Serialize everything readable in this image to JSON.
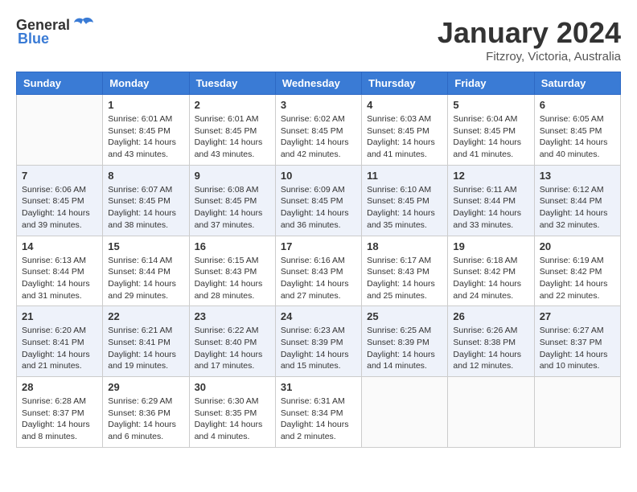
{
  "logo": {
    "general": "General",
    "blue": "Blue"
  },
  "title": "January 2024",
  "subtitle": "Fitzroy, Victoria, Australia",
  "days_of_week": [
    "Sunday",
    "Monday",
    "Tuesday",
    "Wednesday",
    "Thursday",
    "Friday",
    "Saturday"
  ],
  "weeks": [
    [
      {
        "day": "",
        "info": ""
      },
      {
        "day": "1",
        "info": "Sunrise: 6:01 AM\nSunset: 8:45 PM\nDaylight: 14 hours\nand 43 minutes."
      },
      {
        "day": "2",
        "info": "Sunrise: 6:01 AM\nSunset: 8:45 PM\nDaylight: 14 hours\nand 43 minutes."
      },
      {
        "day": "3",
        "info": "Sunrise: 6:02 AM\nSunset: 8:45 PM\nDaylight: 14 hours\nand 42 minutes."
      },
      {
        "day": "4",
        "info": "Sunrise: 6:03 AM\nSunset: 8:45 PM\nDaylight: 14 hours\nand 41 minutes."
      },
      {
        "day": "5",
        "info": "Sunrise: 6:04 AM\nSunset: 8:45 PM\nDaylight: 14 hours\nand 41 minutes."
      },
      {
        "day": "6",
        "info": "Sunrise: 6:05 AM\nSunset: 8:45 PM\nDaylight: 14 hours\nand 40 minutes."
      }
    ],
    [
      {
        "day": "7",
        "info": "Sunrise: 6:06 AM\nSunset: 8:45 PM\nDaylight: 14 hours\nand 39 minutes."
      },
      {
        "day": "8",
        "info": "Sunrise: 6:07 AM\nSunset: 8:45 PM\nDaylight: 14 hours\nand 38 minutes."
      },
      {
        "day": "9",
        "info": "Sunrise: 6:08 AM\nSunset: 8:45 PM\nDaylight: 14 hours\nand 37 minutes."
      },
      {
        "day": "10",
        "info": "Sunrise: 6:09 AM\nSunset: 8:45 PM\nDaylight: 14 hours\nand 36 minutes."
      },
      {
        "day": "11",
        "info": "Sunrise: 6:10 AM\nSunset: 8:45 PM\nDaylight: 14 hours\nand 35 minutes."
      },
      {
        "day": "12",
        "info": "Sunrise: 6:11 AM\nSunset: 8:44 PM\nDaylight: 14 hours\nand 33 minutes."
      },
      {
        "day": "13",
        "info": "Sunrise: 6:12 AM\nSunset: 8:44 PM\nDaylight: 14 hours\nand 32 minutes."
      }
    ],
    [
      {
        "day": "14",
        "info": "Sunrise: 6:13 AM\nSunset: 8:44 PM\nDaylight: 14 hours\nand 31 minutes."
      },
      {
        "day": "15",
        "info": "Sunrise: 6:14 AM\nSunset: 8:44 PM\nDaylight: 14 hours\nand 29 minutes."
      },
      {
        "day": "16",
        "info": "Sunrise: 6:15 AM\nSunset: 8:43 PM\nDaylight: 14 hours\nand 28 minutes."
      },
      {
        "day": "17",
        "info": "Sunrise: 6:16 AM\nSunset: 8:43 PM\nDaylight: 14 hours\nand 27 minutes."
      },
      {
        "day": "18",
        "info": "Sunrise: 6:17 AM\nSunset: 8:43 PM\nDaylight: 14 hours\nand 25 minutes."
      },
      {
        "day": "19",
        "info": "Sunrise: 6:18 AM\nSunset: 8:42 PM\nDaylight: 14 hours\nand 24 minutes."
      },
      {
        "day": "20",
        "info": "Sunrise: 6:19 AM\nSunset: 8:42 PM\nDaylight: 14 hours\nand 22 minutes."
      }
    ],
    [
      {
        "day": "21",
        "info": "Sunrise: 6:20 AM\nSunset: 8:41 PM\nDaylight: 14 hours\nand 21 minutes."
      },
      {
        "day": "22",
        "info": "Sunrise: 6:21 AM\nSunset: 8:41 PM\nDaylight: 14 hours\nand 19 minutes."
      },
      {
        "day": "23",
        "info": "Sunrise: 6:22 AM\nSunset: 8:40 PM\nDaylight: 14 hours\nand 17 minutes."
      },
      {
        "day": "24",
        "info": "Sunrise: 6:23 AM\nSunset: 8:39 PM\nDaylight: 14 hours\nand 15 minutes."
      },
      {
        "day": "25",
        "info": "Sunrise: 6:25 AM\nSunset: 8:39 PM\nDaylight: 14 hours\nand 14 minutes."
      },
      {
        "day": "26",
        "info": "Sunrise: 6:26 AM\nSunset: 8:38 PM\nDaylight: 14 hours\nand 12 minutes."
      },
      {
        "day": "27",
        "info": "Sunrise: 6:27 AM\nSunset: 8:37 PM\nDaylight: 14 hours\nand 10 minutes."
      }
    ],
    [
      {
        "day": "28",
        "info": "Sunrise: 6:28 AM\nSunset: 8:37 PM\nDaylight: 14 hours\nand 8 minutes."
      },
      {
        "day": "29",
        "info": "Sunrise: 6:29 AM\nSunset: 8:36 PM\nDaylight: 14 hours\nand 6 minutes."
      },
      {
        "day": "30",
        "info": "Sunrise: 6:30 AM\nSunset: 8:35 PM\nDaylight: 14 hours\nand 4 minutes."
      },
      {
        "day": "31",
        "info": "Sunrise: 6:31 AM\nSunset: 8:34 PM\nDaylight: 14 hours\nand 2 minutes."
      },
      {
        "day": "",
        "info": ""
      },
      {
        "day": "",
        "info": ""
      },
      {
        "day": "",
        "info": ""
      }
    ]
  ]
}
